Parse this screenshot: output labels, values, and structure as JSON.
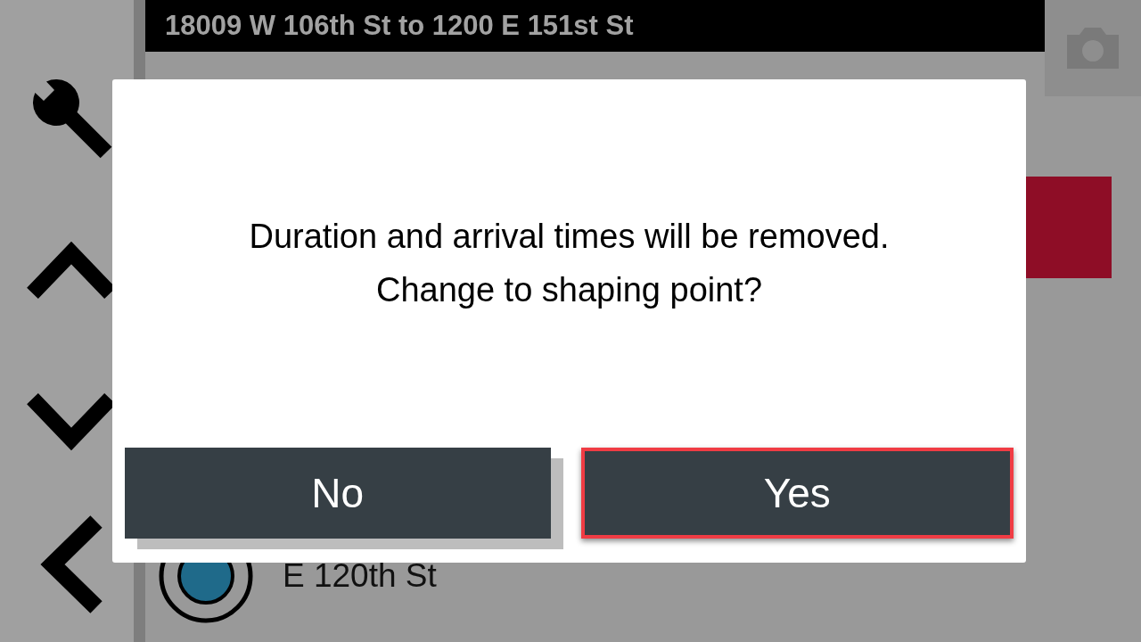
{
  "header": {
    "title": "18009 W 106th St to 1200 E 151st St"
  },
  "route_stops": [
    {
      "name": "E 120th St"
    }
  ],
  "dialog": {
    "message_lines": [
      "Duration and arrival times will be removed.",
      "Change to shaping point?"
    ],
    "buttons": [
      {
        "label": "No",
        "selected": false
      },
      {
        "label": "Yes",
        "selected": true
      }
    ]
  }
}
